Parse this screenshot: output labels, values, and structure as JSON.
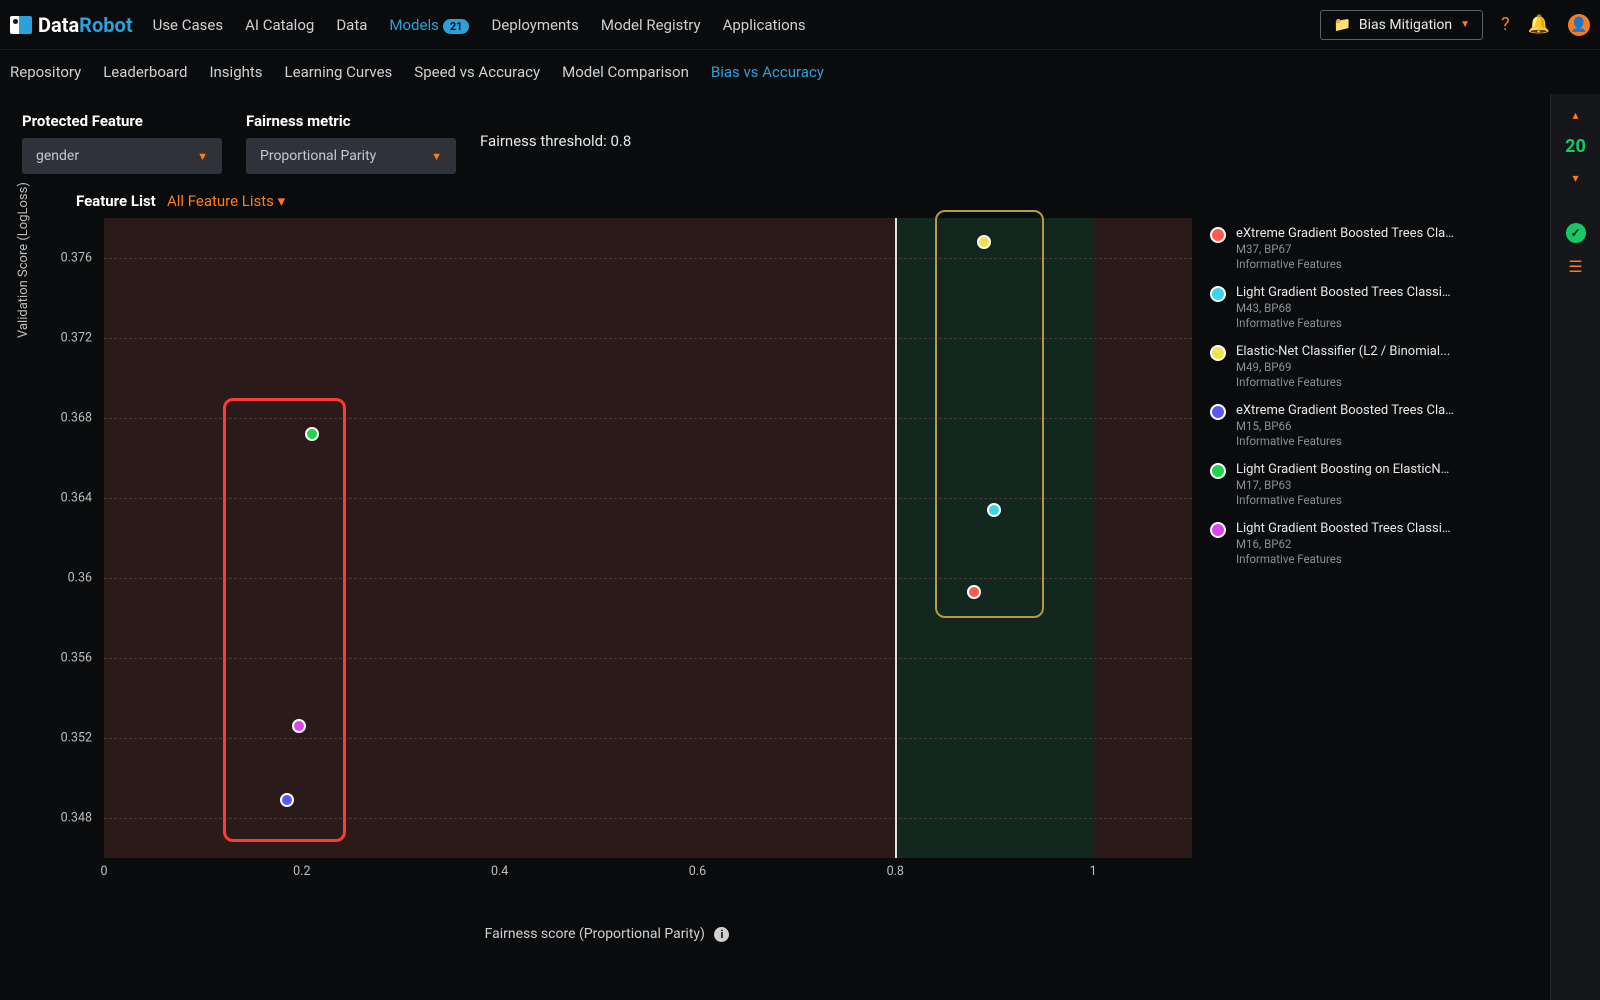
{
  "brand": {
    "first": "Data",
    "second": "Robot"
  },
  "topnav": {
    "items": [
      "Use Cases",
      "AI Catalog",
      "Data",
      "Models",
      "Deployments",
      "Model Registry",
      "Applications"
    ],
    "active_index": 3,
    "models_badge": "21",
    "project": "Bias Mitigation"
  },
  "subnav": {
    "items": [
      "Repository",
      "Leaderboard",
      "Insights",
      "Learning Curves",
      "Speed vs Accuracy",
      "Model Comparison",
      "Bias vs Accuracy"
    ],
    "active_index": 6
  },
  "controls": {
    "protected_feature_label": "Protected Feature",
    "protected_feature_value": "gender",
    "fairness_metric_label": "Fairness metric",
    "fairness_metric_value": "Proportional Parity",
    "threshold_text": "Fairness threshold: 0.8"
  },
  "feature_list": {
    "label": "Feature List",
    "value": "All Feature Lists"
  },
  "rail": {
    "count": "20"
  },
  "chart_data": {
    "type": "scatter",
    "xlabel": "Fairness score (Proportional Parity)",
    "ylabel": "Validation Score (LogLoss)",
    "xlim": [
      0,
      1.1
    ],
    "ylim": [
      0.346,
      0.378
    ],
    "xticks": [
      0,
      0.2,
      0.4,
      0.6,
      0.8,
      1
    ],
    "yticks": [
      0.348,
      0.352,
      0.356,
      0.36,
      0.364,
      0.368,
      0.372,
      0.376
    ],
    "fairness_threshold": 0.8,
    "series": [
      {
        "name": "eXtreme Gradient Boosted Trees Classi...",
        "sub1": "M37, BP67",
        "sub2": "Informative Features",
        "color": "#ff5a52",
        "x": 0.88,
        "y": 0.3593
      },
      {
        "name": "Light Gradient Boosted Trees Classifi...",
        "sub1": "M43, BP68",
        "sub2": "Informative Features",
        "color": "#38d6e6",
        "x": 0.9,
        "y": 0.3634
      },
      {
        "name": "Elastic-Net Classifier (L2 / Binomial...",
        "sub1": "M49, BP69",
        "sub2": "Informative Features",
        "color": "#f2e24b",
        "x": 0.89,
        "y": 0.3768
      },
      {
        "name": "eXtreme Gradient Boosted Trees Classi...",
        "sub1": "M15, BP66",
        "sub2": "Informative Features",
        "color": "#5b57ff",
        "x": 0.185,
        "y": 0.3489
      },
      {
        "name": "Light Gradient Boosting on ElasticNet...",
        "sub1": "M17, BP63",
        "sub2": "Informative Features",
        "color": "#22d34a",
        "x": 0.21,
        "y": 0.3672
      },
      {
        "name": "Light Gradient Boosted Trees Classifi...",
        "sub1": "M16, BP62",
        "sub2": "Informative Features",
        "color": "#d946ef",
        "x": 0.197,
        "y": 0.3526
      }
    ],
    "highlight_boxes": [
      {
        "kind": "red",
        "xmin": 0.12,
        "xmax": 0.245,
        "ymin": 0.3468,
        "ymax": 0.369
      },
      {
        "kind": "gold",
        "xmin": 0.84,
        "xmax": 0.95,
        "ymin": 0.358,
        "ymax": 0.3784
      }
    ]
  }
}
